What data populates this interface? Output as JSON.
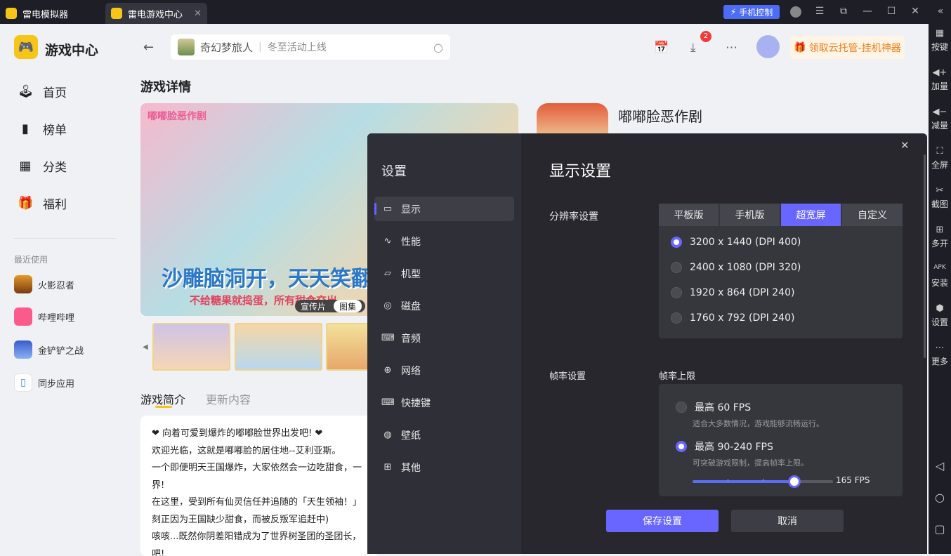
{
  "titlebar": {
    "tabs": [
      "雷电模拟器",
      "雷电游戏中心"
    ],
    "phone_control": "手机控制"
  },
  "right_toolbar": [
    {
      "label": "按键",
      "icon": "keyboard-icon",
      "glyph": "▦"
    },
    {
      "label": "加量",
      "icon": "volume-up-icon",
      "glyph": "◀+"
    },
    {
      "label": "减量",
      "icon": "volume-down-icon",
      "glyph": "◀−"
    },
    {
      "label": "全屏",
      "icon": "fullscreen-icon",
      "glyph": "⛶"
    },
    {
      "label": "截图",
      "icon": "scissors-icon",
      "glyph": "✂"
    },
    {
      "label": "多开",
      "icon": "multi-instance-icon",
      "glyph": "⊞"
    },
    {
      "label": "安装",
      "icon": "apk-install-icon",
      "glyph": "APK"
    },
    {
      "label": "设置",
      "icon": "settings-icon",
      "glyph": "⬢"
    },
    {
      "label": "更多",
      "icon": "more-icon",
      "glyph": "⋯"
    }
  ],
  "sidebar": {
    "title": "游戏中心",
    "nav": [
      "首页",
      "榜单",
      "分类",
      "福利"
    ],
    "recent_label": "最近使用",
    "recent": [
      "火影忍者",
      "哔哩哔哩",
      "金铲铲之战",
      "同步应用"
    ]
  },
  "header": {
    "search_game": "奇幻梦旅人",
    "search_placeholder": "冬至活动上线",
    "download_badge": "2",
    "gift_label": "领取云托管-挂机神器"
  },
  "detail": {
    "heading": "游戏详情",
    "game_name": "嘟嘟脸恶作剧",
    "banner_logo": "嘟嘟脸恶作剧",
    "banner_headline": "沙雕脑洞开，天天笑翻",
    "banner_sub": "不给糖果就捣蛋，所有甜食交出",
    "media_tabs": [
      "宣传片",
      "图集"
    ],
    "tabs": [
      "游戏简介",
      "更新内容"
    ],
    "intro": [
      "❤ 向着可爱到爆炸的嘟嘟脸世界出发吧! ❤",
      "欢迎光临，这就是嘟嘟脸的居住地--艾利亚斯。",
      "一个即便明天王国爆炸，大家依然会一边吃甜食，一",
      "界!",
      "在这里，受到所有仙灵信任并追随的「天生领袖！」",
      "刻正因为王国缺少甜食，而被反叛军追赶中)",
      "咳咳...既然你阴差阳错成为了世界树圣团的圣团长，",
      "吧!"
    ]
  },
  "settings": {
    "title": "设置",
    "nav": [
      {
        "label": "显示",
        "glyph": "▭",
        "icon": "monitor-icon"
      },
      {
        "label": "性能",
        "glyph": "∿",
        "icon": "performance-icon"
      },
      {
        "label": "机型",
        "glyph": "▱",
        "icon": "folder-icon"
      },
      {
        "label": "磁盘",
        "glyph": "◎",
        "icon": "disk-icon"
      },
      {
        "label": "音频",
        "glyph": "⌨",
        "icon": "gamepad-icon"
      },
      {
        "label": "网络",
        "glyph": "⊕",
        "icon": "globe-icon"
      },
      {
        "label": "快捷键",
        "glyph": "⌨",
        "icon": "keyboard-icon"
      },
      {
        "label": "壁纸",
        "glyph": "◍",
        "icon": "palette-icon"
      },
      {
        "label": "其他",
        "glyph": "⊞",
        "icon": "grid-icon"
      }
    ],
    "section_title": "显示设置",
    "resolution_label": "分辨率设置",
    "modes": [
      "平板版",
      "手机版",
      "超宽屏",
      "自定义"
    ],
    "selected_mode": 2,
    "resolutions": [
      "3200 x 1440  (DPI 400)",
      "2400 x 1080  (DPI 320)",
      "1920 x 864  (DPI 240)",
      "1760 x 792  (DPI 240)"
    ],
    "selected_resolution": 0,
    "fps_label": "帧率设置",
    "fps_limit_label": "帧率上限",
    "fps_options": [
      {
        "title": "最高 60 FPS",
        "desc": "适合大多数情况，游戏能够流畅运行。"
      },
      {
        "title": "最高 90-240 FPS",
        "desc": "可突破游戏限制，提高帧率上限。"
      }
    ],
    "selected_fps": 1,
    "fps_value": "165 FPS",
    "fps_slider_fraction": 0.725,
    "save": "保存设置",
    "cancel": "取消"
  },
  "colors": {
    "accent": "#6966ff",
    "brand": "#f5c518"
  }
}
